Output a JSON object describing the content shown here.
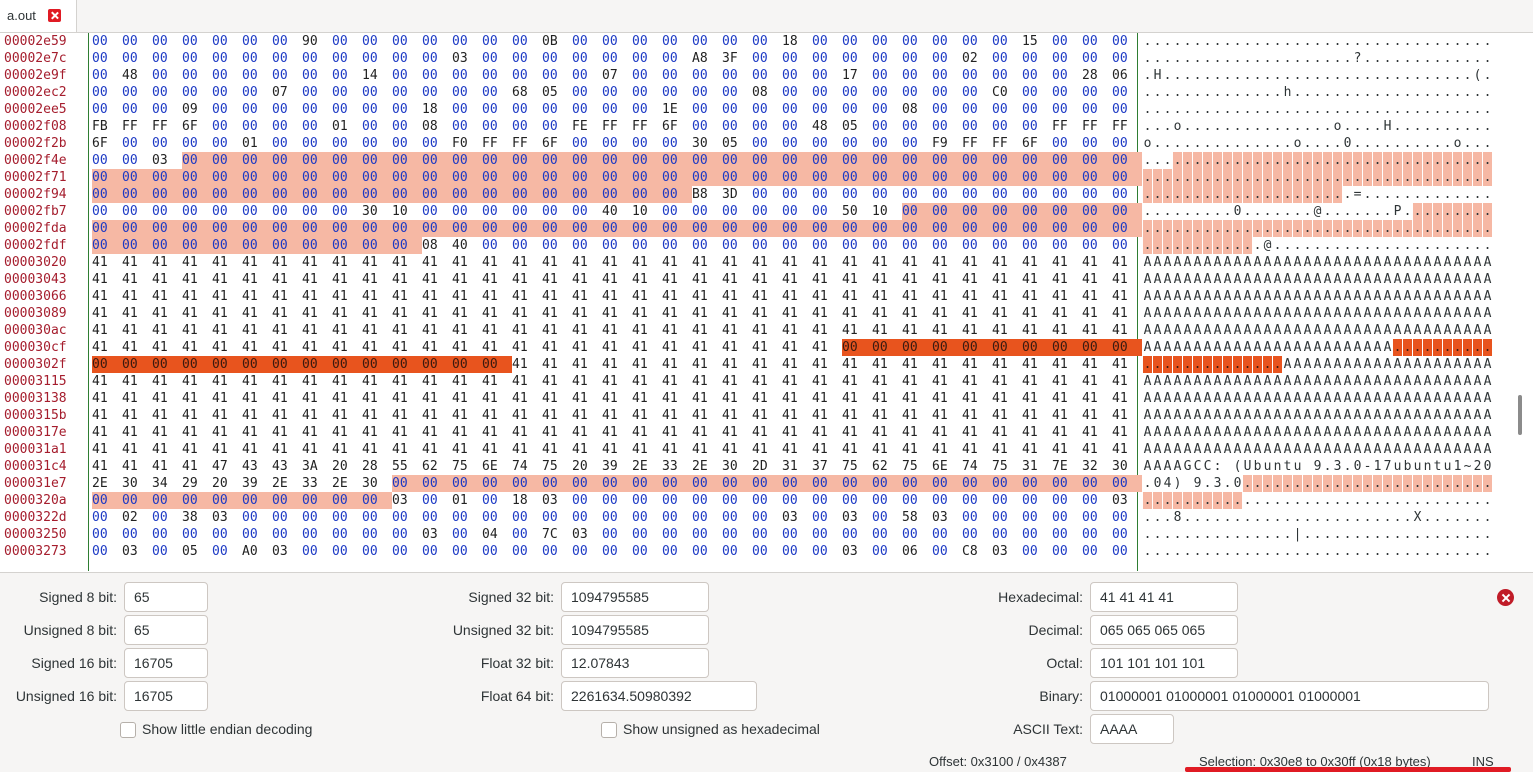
{
  "tab": {
    "title": "a.out"
  },
  "hex": {
    "rows": [
      {
        "offset": "00002e59",
        "bytes": "00 00 00 00 00 00 00 90 00 00 00 00 00 00 00 0B 00 00 00 00 00 00 00 18 00 00 00 00 00 00 00 15 00 00 00"
      },
      {
        "offset": "00002e7c",
        "bytes": "00 00 00 00 00 00 00 00 00 00 00 00 03 00 00 00 00 00 00 00 A8 3F 00 00 00 00 00 00 00 02 00 00 00 00 00"
      },
      {
        "offset": "00002e9f",
        "bytes": "00 48 00 00 00 00 00 00 00 14 00 00 00 00 00 00 00 07 00 00 00 00 00 00 00 17 00 00 00 00 00 00 00 28 06"
      },
      {
        "offset": "00002ec2",
        "bytes": "00 00 00 00 00 00 07 00 00 00 00 00 00 00 68 05 00 00 00 00 00 00 08 00 00 00 00 00 00 00 C0 00 00 00 00"
      },
      {
        "offset": "00002ee5",
        "bytes": "00 00 00 09 00 00 00 00 00 00 00 18 00 00 00 00 00 00 00 1E 00 00 00 00 00 00 00 08 00 00 00 00 00 00 00"
      },
      {
        "offset": "00002f08",
        "bytes": "FB FF FF 6F 00 00 00 00 01 00 00 08 00 00 00 00 FE FF FF 6F 00 00 00 00 48 05 00 00 00 00 00 00 FF FF FF"
      },
      {
        "offset": "00002f2b",
        "bytes": "6F 00 00 00 00 01 00 00 00 00 00 00 F0 FF FF 6F 00 00 00 00 30 05 00 00 00 00 00 00 F9 FF FF 6F 00 00 00"
      },
      {
        "offset": "00002f4e",
        "bytes": "00 00 03 00 00 00 00 00 00 00 00 00 00 00 00 00 00 00 00 00 00 00 00 00 00 00 00 00 00 00 00 00 00 00 00"
      },
      {
        "offset": "00002f71",
        "bytes": "00 00 00 00 00 00 00 00 00 00 00 00 00 00 00 00 00 00 00 00 00 00 00 00 00 00 00 00 00 00 00 00 00 00 00"
      },
      {
        "offset": "00002f94",
        "bytes": "00 00 00 00 00 00 00 00 00 00 00 00 00 00 00 00 00 00 00 00 B8 3D 00 00 00 00 00 00 00 00 00 00 00 00 00"
      },
      {
        "offset": "00002fb7",
        "bytes": "00 00 00 00 00 00 00 00 00 30 10 00 00 00 00 00 00 40 10 00 00 00 00 00 00 50 10 00 00 00 00 00 00 00 00"
      },
      {
        "offset": "00002fda",
        "bytes": "00 00 00 00 00 00 00 00 00 00 00 00 00 00 00 00 00 00 00 00 00 00 00 00 00 00 00 00 00 00 00 00 00 00 00"
      },
      {
        "offset": "00002fdf",
        "bytes": "00 00 00 00 00 00 00 00 00 00 00 08 40 00 00 00 00 00 00 00 00 00 00 00 00 00 00 00 00 00 00 00 00 00 00"
      },
      {
        "offset": "00003020",
        "bytes": "41 41 41 41 41 41 41 41 41 41 41 41 41 41 41 41 41 41 41 41 41 41 41 41 41 41 41 41 41 41 41 41 41 41 41"
      },
      {
        "offset": "00003043",
        "bytes": "41 41 41 41 41 41 41 41 41 41 41 41 41 41 41 41 41 41 41 41 41 41 41 41 41 41 41 41 41 41 41 41 41 41 41"
      },
      {
        "offset": "00003066",
        "bytes": "41 41 41 41 41 41 41 41 41 41 41 41 41 41 41 41 41 41 41 41 41 41 41 41 41 41 41 41 41 41 41 41 41 41 41"
      },
      {
        "offset": "00003089",
        "bytes": "41 41 41 41 41 41 41 41 41 41 41 41 41 41 41 41 41 41 41 41 41 41 41 41 41 41 41 41 41 41 41 41 41 41 41"
      },
      {
        "offset": "000030ac",
        "bytes": "41 41 41 41 41 41 41 41 41 41 41 41 41 41 41 41 41 41 41 41 41 41 41 41 41 41 41 41 41 41 41 41 41 41 41"
      },
      {
        "offset": "000030cf",
        "bytes": "41 41 41 41 41 41 41 41 41 41 41 41 41 41 41 41 41 41 41 41 41 41 41 41 41 00 00 00 00 00 00 00 00 00 00"
      },
      {
        "offset": "0000302f",
        "bytes": "00 00 00 00 00 00 00 00 00 00 00 00 00 00 41 41 41 41 41 41 41 41 41 41 41 41 41 41 41 41 41 41 41 41 41"
      },
      {
        "offset": "00003115",
        "bytes": "41 41 41 41 41 41 41 41 41 41 41 41 41 41 41 41 41 41 41 41 41 41 41 41 41 41 41 41 41 41 41 41 41 41 41"
      },
      {
        "offset": "00003138",
        "bytes": "41 41 41 41 41 41 41 41 41 41 41 41 41 41 41 41 41 41 41 41 41 41 41 41 41 41 41 41 41 41 41 41 41 41 41"
      },
      {
        "offset": "0000315b",
        "bytes": "41 41 41 41 41 41 41 41 41 41 41 41 41 41 41 41 41 41 41 41 41 41 41 41 41 41 41 41 41 41 41 41 41 41 41"
      },
      {
        "offset": "0000317e",
        "bytes": "41 41 41 41 41 41 41 41 41 41 41 41 41 41 41 41 41 41 41 41 41 41 41 41 41 41 41 41 41 41 41 41 41 41 41"
      },
      {
        "offset": "000031a1",
        "bytes": "41 41 41 41 41 41 41 41 41 41 41 41 41 41 41 41 41 41 41 41 41 41 41 41 41 41 41 41 41 41 41 41 41 41 41"
      },
      {
        "offset": "000031c4",
        "bytes": "41 41 41 41 47 43 43 3A 20 28 55 62 75 6E 74 75 20 39 2E 33 2E 30 2D 31 37 75 62 75 6E 74 75 31 7E 32 30"
      },
      {
        "offset": "000031e7",
        "bytes": "2E 30 34 29 20 39 2E 33 2E 30 00 00 00 00 00 00 00 00 00 00 00 00 00 00 00 00 00 00 00 00 00 00 00 00 00"
      },
      {
        "offset": "0000320a",
        "bytes": "00 00 00 00 00 00 00 00 00 00 03 00 01 00 18 03 00 00 00 00 00 00 00 00 00 00 00 00 00 00 00 00 00 00 03"
      },
      {
        "offset": "0000322d",
        "bytes": "00 02 00 38 03 00 00 00 00 00 00 00 00 00 00 00 00 00 00 00 00 00 00 03 00 03 00 58 03 00 00 00 00 00 00"
      },
      {
        "offset": "00003250",
        "bytes": "00 00 00 00 00 00 00 00 00 00 00 03 00 04 00 7C 03 00 00 00 00 00 00 00 00 00 00 00 00 00 00 00 00 00 00"
      },
      {
        "offset": "00003273",
        "bytes": "00 03 00 05 00 A0 03 00 00 00 00 00 00 00 00 00 00 00 00 00 00 00 00 00 00 03 00 06 00 C8 03 00 00 00 00"
      }
    ]
  },
  "inspector": {
    "signed8": {
      "label": "Signed 8 bit:",
      "value": "65"
    },
    "unsigned8": {
      "label": "Unsigned 8 bit:",
      "value": "65"
    },
    "signed16": {
      "label": "Signed 16 bit:",
      "value": "16705"
    },
    "unsigned16": {
      "label": "Unsigned 16 bit:",
      "value": "16705"
    },
    "signed32": {
      "label": "Signed 32 bit:",
      "value": "1094795585"
    },
    "unsigned32": {
      "label": "Unsigned 32 bit:",
      "value": "1094795585"
    },
    "float32": {
      "label": "Float 32 bit:",
      "value": "12.07843"
    },
    "float64": {
      "label": "Float 64 bit:",
      "value": "2261634.50980392"
    },
    "hex": {
      "label": "Hexadecimal:",
      "value": "41 41 41 41"
    },
    "decimal": {
      "label": "Decimal:",
      "value": "065 065 065 065"
    },
    "octal": {
      "label": "Octal:",
      "value": "101 101 101 101"
    },
    "binary": {
      "label": "Binary:",
      "value": "01000001 01000001 01000001 01000001"
    },
    "ascii": {
      "label": "ASCII Text:",
      "value": "AAAA"
    },
    "little_endian_label": "Show little endian decoding",
    "unsigned_hex_label": "Show unsigned as hexadecimal"
  },
  "status": {
    "offset": "Offset: 0x3100 / 0x4387",
    "selection": "Selection: 0x30e8 to 0x30ff (0x18 bytes)",
    "mode": "INS"
  },
  "colors": {
    "offset_text": "#a51d2d",
    "zero_byte": "#1c39c4",
    "selection_light": "#f6b8a4",
    "selection_dark": "#e8541e"
  }
}
